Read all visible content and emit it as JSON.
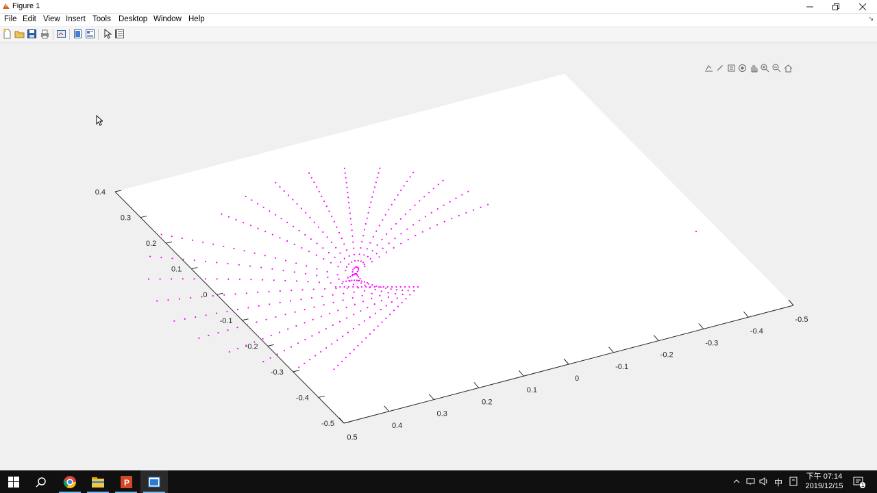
{
  "window": {
    "title": "Figure 1"
  },
  "menu": [
    "File",
    "Edit",
    "View",
    "Insert",
    "Tools",
    "Desktop",
    "Window",
    "Help"
  ],
  "toolbar": {
    "buttons": [
      "new-figure",
      "open-file",
      "save-figure",
      "print-figure",
      "link-plot",
      "hide-plot-tools",
      "show-plot-tools",
      "edit-plot",
      "open-property-inspector"
    ]
  },
  "axes_toolbar": [
    "export-icon",
    "brush-icon",
    "datatip-icon",
    "rotate-icon",
    "pan-icon",
    "zoom-in-icon",
    "zoom-out-icon",
    "home-icon"
  ],
  "colors": {
    "marker": "#ff00ff",
    "axes_bg": "#ffffff",
    "figure_bg": "#f0f0f0",
    "taskbar": "#101010"
  },
  "chart_data": {
    "type": "scatter",
    "title": "",
    "xlabel": "",
    "ylabel": "",
    "zlabel": "",
    "xlim": [
      -0.5,
      0.5
    ],
    "ylim": [
      -0.5,
      0.5
    ],
    "zlim": [
      -0.5,
      0.4
    ],
    "x_ticks": [
      "-0.5",
      "-0.4",
      "-0.3",
      "-0.2",
      "-0.1",
      "0",
      "0.1",
      "0.2",
      "0.3",
      "0.4",
      "0.5"
    ],
    "z_ticks": [
      "-0.5",
      "-0.4",
      "-0.3",
      "-0.2",
      "-0.1",
      "0",
      "0.1",
      "0.2",
      "0.3",
      "0.4"
    ],
    "grid": false,
    "legend": "none",
    "view": "3-D",
    "series": [
      {
        "marker": "point",
        "color": "#ff00ff",
        "description_values": {
          "rays": 20,
          "points_per_ray": 22,
          "surface": "saddle / helicoid-like ruled surface, z in [-0.45, 0.35]"
        }
      }
    ]
  },
  "taskbar": {
    "apps": [
      "start-icon",
      "search-icon",
      "chrome-icon",
      "file-explorer-icon",
      "powerpoint-icon",
      "matlab-figure-icon"
    ],
    "tray": {
      "ime": "中",
      "time": "下午 07:14",
      "date": "2019/12/15",
      "notification_count": "1"
    }
  }
}
